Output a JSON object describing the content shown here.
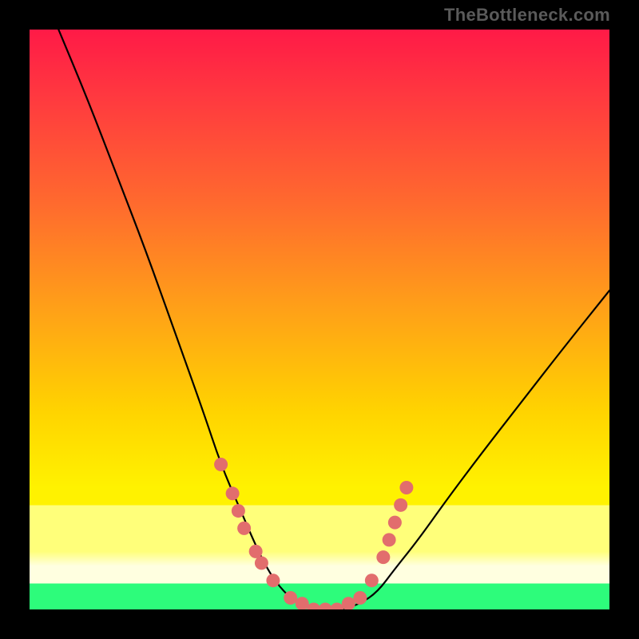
{
  "attribution": "TheBottleneck.com",
  "chart_data": {
    "type": "line",
    "title": "",
    "xlabel": "",
    "ylabel": "",
    "xlim": [
      0,
      100
    ],
    "ylim": [
      0,
      100
    ],
    "grid": false,
    "legend": false,
    "note": "Bottleneck-style curve. x is normalized component scale (0–100 across plot width); y is bottleneck severity in percent (0 at valley floor, 100 at top). Values read from pixel positions; no axis ticks shown in source image.",
    "series": [
      {
        "name": "bottleneck-curve",
        "x": [
          5,
          10,
          15,
          20,
          25,
          30,
          33,
          36,
          39,
          41,
          43,
          46,
          50,
          54,
          57,
          60,
          63,
          67,
          72,
          78,
          85,
          92,
          100
        ],
        "y": [
          100,
          88,
          75,
          62,
          48,
          34,
          25,
          18,
          11,
          7,
          4,
          1,
          0,
          0,
          1,
          3,
          7,
          12,
          19,
          27,
          36,
          45,
          55
        ]
      }
    ],
    "markers": {
      "name": "highlighted-points",
      "color": "#e26d6d",
      "points": [
        {
          "x": 33,
          "y": 25
        },
        {
          "x": 35,
          "y": 20
        },
        {
          "x": 36,
          "y": 17
        },
        {
          "x": 37,
          "y": 14
        },
        {
          "x": 39,
          "y": 10
        },
        {
          "x": 40,
          "y": 8
        },
        {
          "x": 42,
          "y": 5
        },
        {
          "x": 45,
          "y": 2
        },
        {
          "x": 47,
          "y": 1
        },
        {
          "x": 49,
          "y": 0
        },
        {
          "x": 51,
          "y": 0
        },
        {
          "x": 53,
          "y": 0
        },
        {
          "x": 55,
          "y": 1
        },
        {
          "x": 57,
          "y": 2
        },
        {
          "x": 59,
          "y": 5
        },
        {
          "x": 61,
          "y": 9
        },
        {
          "x": 62,
          "y": 12
        },
        {
          "x": 63,
          "y": 15
        },
        {
          "x": 64,
          "y": 18
        },
        {
          "x": 65,
          "y": 21
        }
      ]
    },
    "background_bands": [
      {
        "name": "red-orange-yellow-gradient",
        "y_from": 7,
        "y_to": 100
      },
      {
        "name": "pale-yellow-band",
        "y_from": 4,
        "y_to": 7
      },
      {
        "name": "green-band",
        "y_from": 0,
        "y_to": 4
      }
    ]
  }
}
